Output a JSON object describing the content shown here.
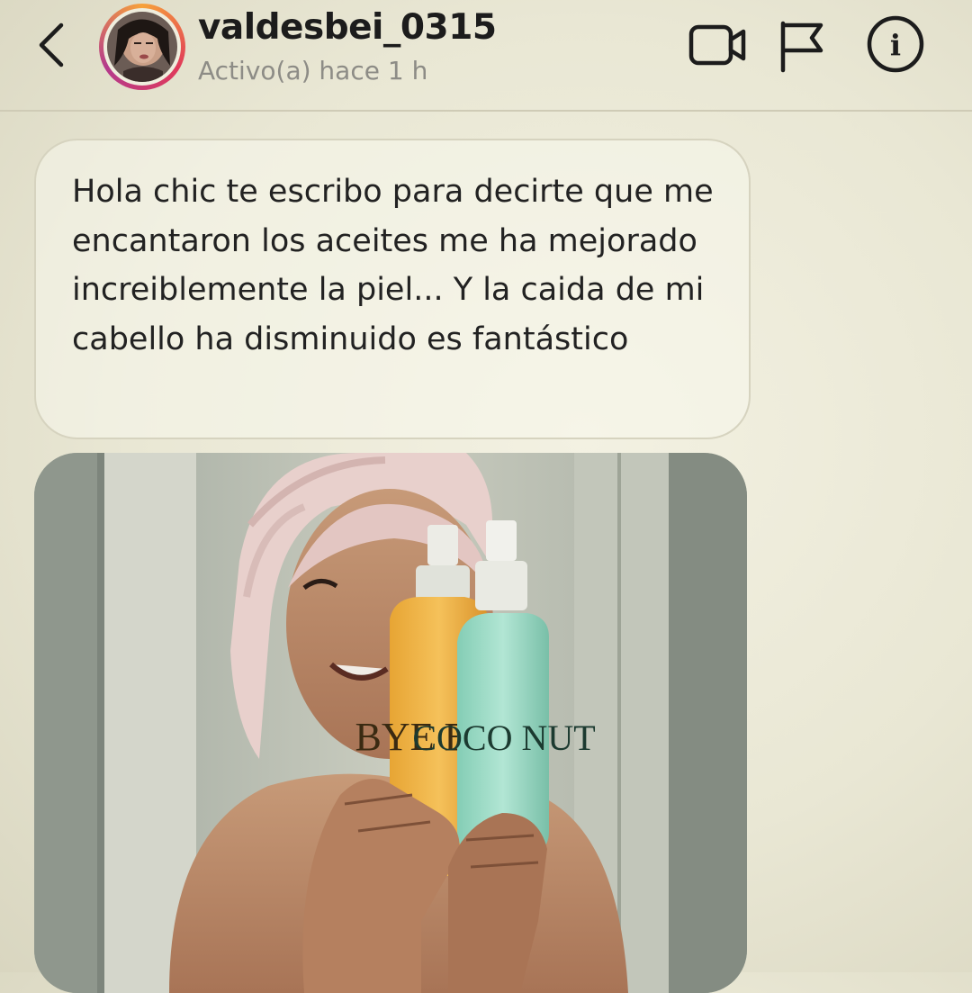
{
  "header": {
    "username": "valdesbei_0315",
    "status": "Activo(a) hace 1 h",
    "back_icon": "chevron-left-icon",
    "actions": [
      {
        "icon": "video-camera-icon"
      },
      {
        "icon": "flag-icon"
      },
      {
        "icon": "info-icon",
        "glyph": "i"
      }
    ]
  },
  "conversation": {
    "message": "Hola chic te escribo para decirte que me encantaron los aceites me ha mejorado increiblemente la piel... Y la caida de mi cabello ha disminuido es fantástico",
    "photo": {
      "bottle_left_label": "BYE BYE",
      "bottle_right_label": "COCO NUT"
    }
  },
  "colors": {
    "background": "#ebe9d6",
    "bubble_border": "#d6d3bf",
    "status_text": "#8d8c86",
    "bottle_left": "#f0b23c",
    "bottle_right": "#9ed9c4"
  }
}
